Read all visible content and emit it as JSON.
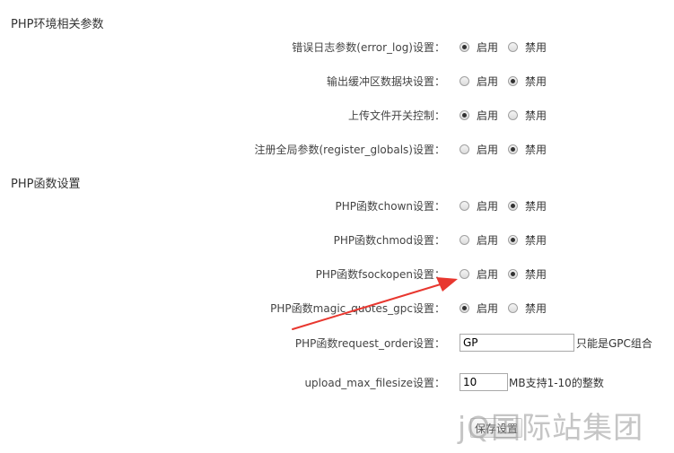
{
  "sections": {
    "env": {
      "title": "PHP环境相关参数"
    },
    "functions": {
      "title": "PHP函数设置"
    }
  },
  "options": {
    "enable": "启用",
    "disable": "禁用"
  },
  "env_rows": [
    {
      "label": "错误日志参数(error_log)设置：",
      "selected": "enable"
    },
    {
      "label": "输出缓冲区数据块设置：",
      "selected": "disable"
    },
    {
      "label": "上传文件开关控制：",
      "selected": "enable"
    },
    {
      "label": "注册全局参数(register_globals)设置：",
      "selected": "disable"
    }
  ],
  "function_rows": [
    {
      "label": "PHP函数chown设置：",
      "selected": "disable"
    },
    {
      "label": "PHP函数chmod设置：",
      "selected": "disable"
    },
    {
      "label": "PHP函数fsockopen设置：",
      "selected": "disable"
    },
    {
      "label": "PHP函数magic_quotes_gpc设置：",
      "selected": "enable"
    }
  ],
  "request_order": {
    "label": "PHP函数request_order设置：",
    "value": "GP",
    "hint": "只能是GPC组合"
  },
  "upload_max_filesize": {
    "label": "upload_max_filesize设置：",
    "value": "10",
    "hint": "MB支持1-10的整数"
  },
  "save_button": {
    "label": "保存设置"
  },
  "watermark": {
    "text": "jQ国际站集团"
  },
  "colors": {
    "arrow": "#e8372f",
    "text": "#333333",
    "border": "#a9a9a9"
  }
}
